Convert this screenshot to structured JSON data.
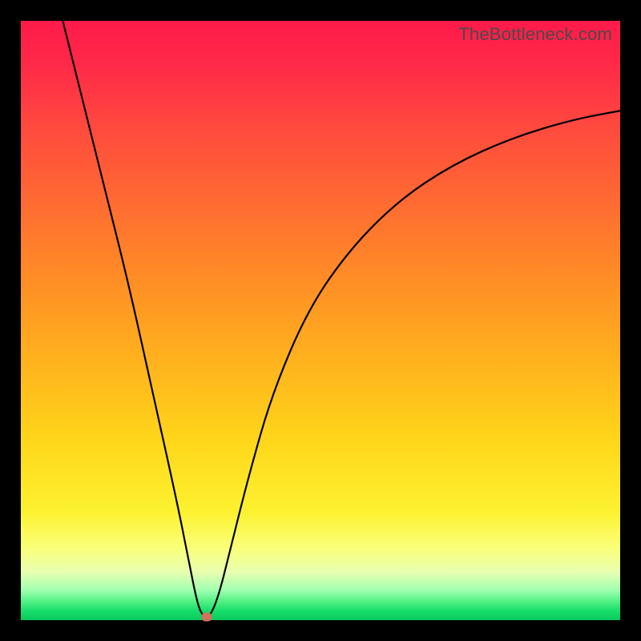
{
  "watermark": "TheBottleneck.com",
  "chart_data": {
    "type": "line",
    "title": "",
    "xlabel": "",
    "ylabel": "",
    "xlim": [
      0,
      100
    ],
    "ylim": [
      0,
      100
    ],
    "curve": {
      "description": "V-shaped bottleneck curve with minimum around x≈30",
      "points": [
        {
          "x": 7,
          "y": 100
        },
        {
          "x": 10,
          "y": 88
        },
        {
          "x": 14,
          "y": 72
        },
        {
          "x": 18,
          "y": 56
        },
        {
          "x": 22,
          "y": 38
        },
        {
          "x": 26,
          "y": 20
        },
        {
          "x": 28,
          "y": 10
        },
        {
          "x": 29.5,
          "y": 2.5
        },
        {
          "x": 30.5,
          "y": 0.5
        },
        {
          "x": 31.5,
          "y": 0.5
        },
        {
          "x": 33,
          "y": 4
        },
        {
          "x": 35,
          "y": 12
        },
        {
          "x": 38,
          "y": 24
        },
        {
          "x": 42,
          "y": 38
        },
        {
          "x": 48,
          "y": 52
        },
        {
          "x": 55,
          "y": 62
        },
        {
          "x": 63,
          "y": 70
        },
        {
          "x": 72,
          "y": 76
        },
        {
          "x": 82,
          "y": 80.5
        },
        {
          "x": 92,
          "y": 83.5
        },
        {
          "x": 100,
          "y": 85
        }
      ]
    },
    "marker": {
      "x": 31,
      "y": 0.5,
      "color": "#d1725a"
    }
  },
  "gradient_colors": {
    "top": "#ff1a4a",
    "mid": "#ffc81e",
    "bottom": "#07c95e"
  }
}
